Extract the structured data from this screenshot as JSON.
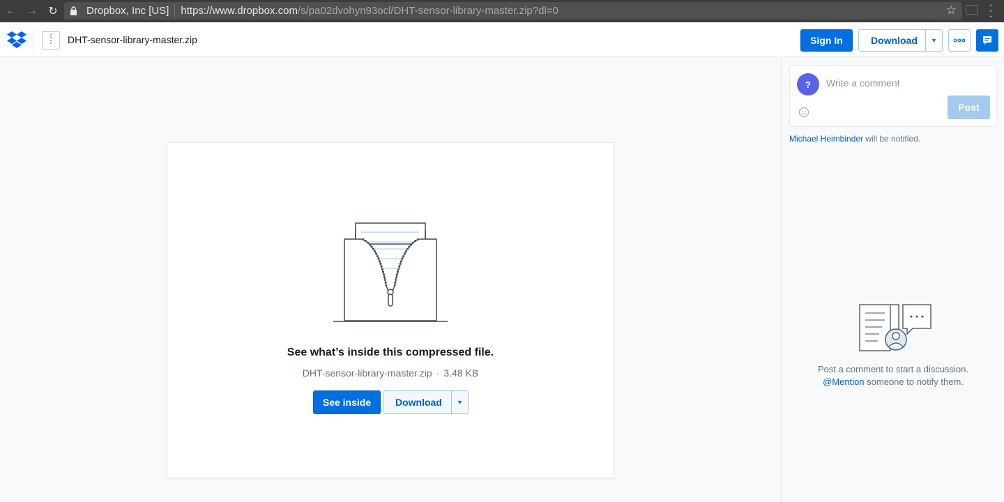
{
  "browser": {
    "site_identity": "Dropbox, Inc [US]",
    "url_host": "https://www.dropbox.com",
    "url_path": "/s/pa02dvohyn93ocl/DHT-sensor-library-master.zip?dl=0"
  },
  "header": {
    "file_name": "DHT-sensor-library-master.zip",
    "sign_in_label": "Sign In",
    "download_label": "Download",
    "more_icon": "ellipsis-icon",
    "comments_icon": "comment-icon"
  },
  "preview": {
    "title": "See what’s inside this compressed file.",
    "file_name": "DHT-sensor-library-master.zip",
    "separator": "·",
    "file_size": "3.48 KB",
    "see_inside_label": "See inside",
    "download_label": "Download"
  },
  "comments": {
    "avatar_letter": "?",
    "placeholder": "Write a comment",
    "post_label": "Post",
    "notify_name": "Michael Heimbinder",
    "notify_suffix": " will be notified.",
    "empty_line1": "Post a comment to start a discussion.",
    "empty_mention": "@Mention",
    "empty_line2_suffix": " someone to notify them."
  },
  "colors": {
    "accent": "#0070e0",
    "avatar": "#5a63e8",
    "post_disabled": "#a3cbf0"
  }
}
